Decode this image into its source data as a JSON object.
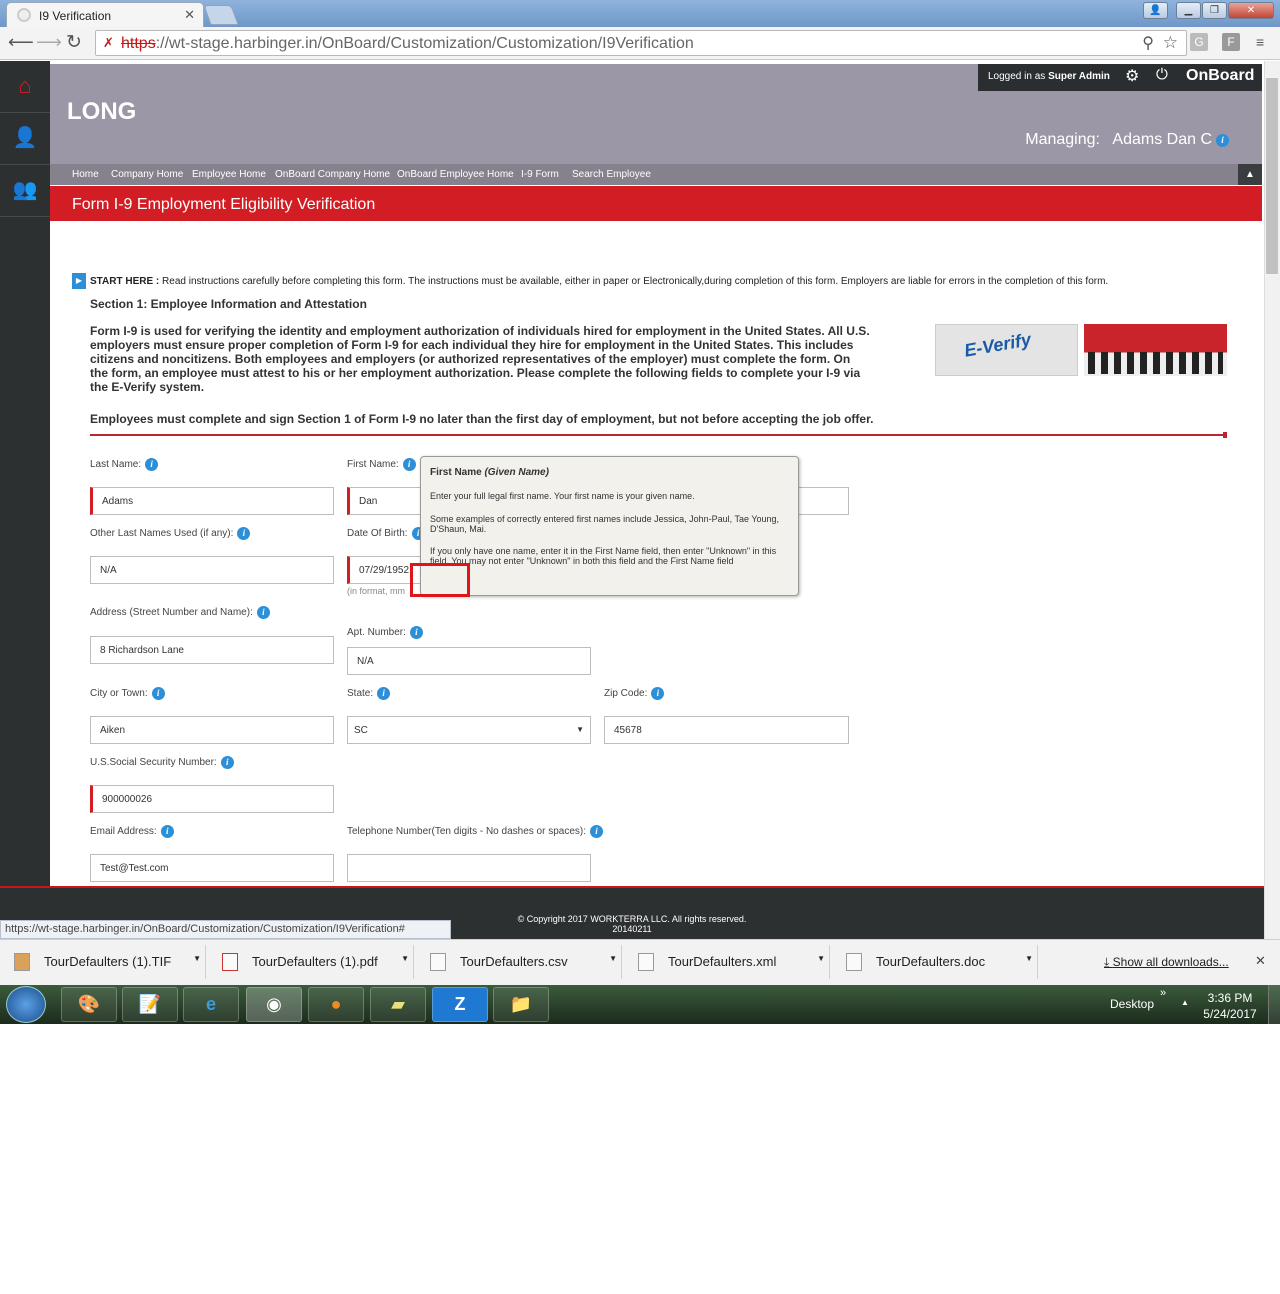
{
  "browser": {
    "tab_title": "I9 Verification",
    "url_scheme": "https",
    "url_rest": "://wt-stage.harbinger.in/OnBoard/Customization/Customization/I9Verification",
    "status_url": "https://wt-stage.harbinger.in/OnBoard/Customization/Customization/I9Verification#"
  },
  "header": {
    "company": "LONG",
    "logged_in_prefix": "Logged in as",
    "logged_in_user": "Super Admin",
    "app_name": "OnBoard",
    "managing_label": "Managing:",
    "managing_name": "Adams Dan C"
  },
  "breadcrumbs": [
    "Home",
    "Company Home",
    "Employee Home",
    "OnBoard Company Home",
    "OnBoard Employee Home",
    "I-9 Form",
    "Search Employee"
  ],
  "page_title": "Form I-9 Employment Eligibility Verification",
  "intro": {
    "start_here": "START HERE :",
    "start_text": "Read instructions carefully before completing this form. The instructions must be available, either in paper or Electronically,during completion of this form. Employers are liable for errors in the completion of this form.",
    "section_title": "Section 1: Employee Information and Attestation",
    "paragraph": "Form I-9 is used for verifying the identity and employment authorization of individuals hired for employment in the United States. All U.S. employers must ensure proper completion of Form I-9 for each individual they hire for employment in the United States. This includes citizens and noncitizens. Both employees and employers (or authorized representatives of the employer) must complete the form. On the form, an employee must attest to his or her employment authorization. Please complete the following fields to complete your I-9 via the E-Verify system.",
    "deadline": "Employees must complete and sign Section 1 of Form I-9 no later than the first day of employment, but not before accepting the job offer.",
    "everify_logo": "E-Verify"
  },
  "form": {
    "last_name": {
      "label": "Last Name:",
      "value": "Adams"
    },
    "first_name": {
      "label": "First Name:",
      "value": "Dan"
    },
    "other_names": {
      "label": "Other Last Names Used (if any):",
      "value": "N/A"
    },
    "dob": {
      "label": "Date Of Birth:",
      "value": "07/29/1952",
      "hint": "(in format, mm"
    },
    "address": {
      "label": "Address (Street Number and Name):",
      "value": "8 Richardson Lane"
    },
    "apt": {
      "label": "Apt. Number:",
      "value": "N/A"
    },
    "city": {
      "label": "City or Town:",
      "value": "Aiken"
    },
    "state": {
      "label": "State:",
      "value": "SC"
    },
    "zip": {
      "label": "Zip Code:",
      "value": "45678"
    },
    "ssn": {
      "label": "U.S.Social Security Number:",
      "value": "900000026"
    },
    "email": {
      "label": "Email Address:",
      "value": "Test@Test.com"
    },
    "phone": {
      "label": "Telephone Number(Ten digits - No dashes or spaces):",
      "value": ""
    }
  },
  "tooltip": {
    "title": "First Name",
    "title_em": "(Given Name)",
    "p1": "Enter your full legal first name. Your first name is your given name.",
    "p2": "Some examples of correctly entered first names include Jessica, John-Paul, Tae Young, D'Shaun, Mai.",
    "p3": "If you only have one name, enter it in the First Name field, then enter \"Unknown\" in this field. You may not enter \"Unknown\" in both this field and the First Name field"
  },
  "footer": {
    "copyright": "© Copyright 2017 WORKTERRA LLC. All rights reserved.",
    "build": "20140211"
  },
  "downloads": [
    "TourDefaulters (1).TIF",
    "TourDefaulters (1).pdf",
    "TourDefaulters.csv",
    "TourDefaulters.xml",
    "TourDefaulters.doc"
  ],
  "downloads_show_all": "Show all downloads...",
  "taskbar": {
    "desktop": "Desktop",
    "time": "3:36 PM",
    "date": "5/24/2017"
  },
  "colors": {
    "brand_red": "#d21d24",
    "header_gray": "#9c97a6",
    "nav_dark": "#2d3031"
  }
}
